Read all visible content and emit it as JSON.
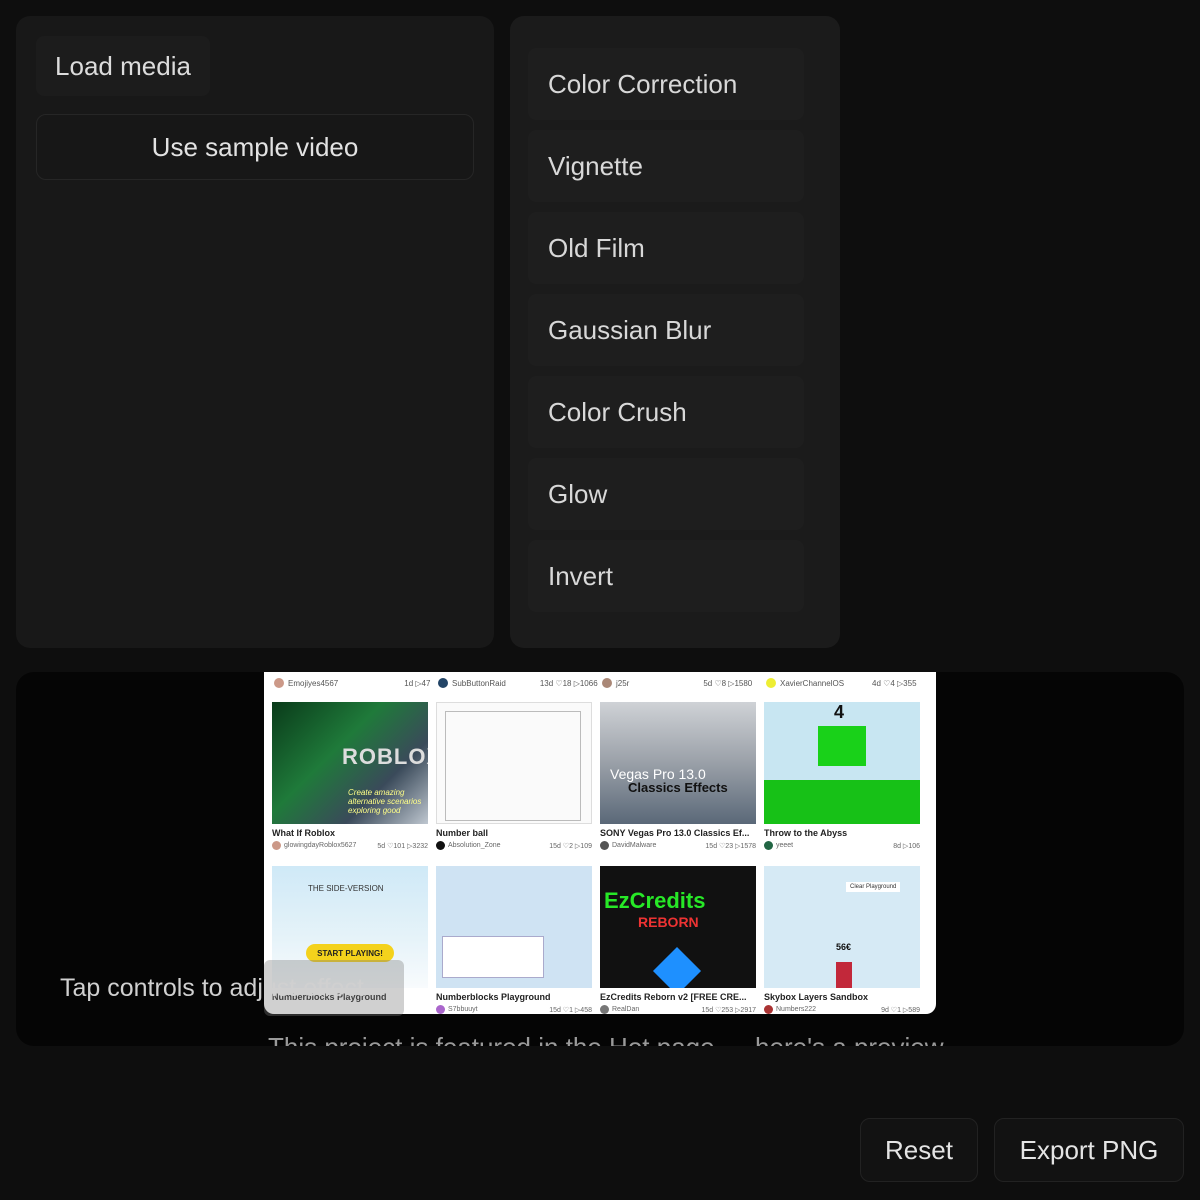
{
  "left": {
    "load_label": "Load media",
    "sample_label": "Use sample video"
  },
  "effects": [
    {
      "label": "Color Correction"
    },
    {
      "label": "Vignette"
    },
    {
      "label": "Old Film"
    },
    {
      "label": "Gaussian Blur"
    },
    {
      "label": "Color Crush"
    },
    {
      "label": "Glow"
    },
    {
      "label": "Invert"
    }
  ],
  "preview": {
    "hint": "Tap controls to adjust effect",
    "caption": "This project is featured in the Hot page — here's a preview",
    "top_row": [
      {
        "user": "Emojiyes4567",
        "stats": "1d ▷47"
      },
      {
        "user": "SubButtonRaid",
        "stats": "13d ♡18 ▷1066"
      },
      {
        "user": "j25r",
        "stats": "5d ♡8 ▷1580"
      },
      {
        "user": "XavierChannelOS",
        "stats": "4d ♡4 ▷355"
      }
    ],
    "cards": [
      {
        "title": "What If Roblox",
        "user": "glowingdayRoblox5627",
        "stats": "5d ♡101 ▷3232",
        "thumb_text": "ROBLOX",
        "thumb_caption": "Create amazing alternative scenarios exploring good"
      },
      {
        "title": "Number ball",
        "user": "Absolution_Zone",
        "stats": "15d ♡2 ▷109",
        "thumb_text": "",
        "thumb_caption": ""
      },
      {
        "title": "SONY Vegas Pro 13.0 Classics Ef...",
        "user": "DavidMalware",
        "stats": "15d ♡23 ▷1578",
        "thumb_text": "Vegas Pro 13.0",
        "thumb_caption": "Classics Effects"
      },
      {
        "title": "Throw to the Abyss",
        "user": "yeeet",
        "stats": "8d ▷106",
        "thumb_text": "4",
        "thumb_caption": ""
      },
      {
        "title": "Numberblocks Playground",
        "user": "",
        "stats": "",
        "thumb_text": "THE SIDE-VERSION",
        "thumb_caption": "START PLAYING!"
      },
      {
        "title": "Numberblocks Playground",
        "user": "S7bbuuyt",
        "stats": "15d ♡1 ▷458",
        "thumb_text": "",
        "thumb_caption": ""
      },
      {
        "title": "EzCredits Reborn v2 [FREE CRE...",
        "user": "RealDan",
        "stats": "15d ♡253 ▷2917",
        "thumb_text": "EzCredits",
        "thumb_caption": "REBORN"
      },
      {
        "title": "Skybox Layers Sandbox",
        "user": "Numbers222",
        "stats": "9d ♡1 ▷589",
        "thumb_text": "Clear Playground",
        "thumb_caption": "56€"
      }
    ]
  },
  "actions": {
    "reset_label": "Reset",
    "export_label": "Export PNG"
  },
  "colors": {
    "background": "#0e0e0e",
    "panel": "#181818",
    "text": "#e6e6e6"
  }
}
